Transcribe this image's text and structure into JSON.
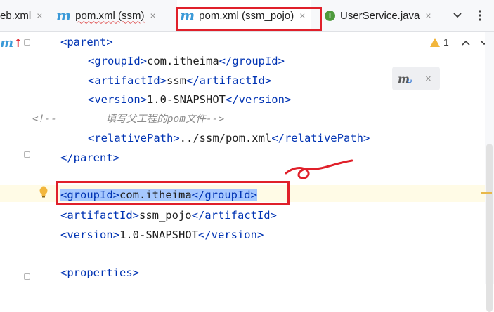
{
  "tabs": [
    {
      "label": "eb.xml",
      "icon": "xml-file-icon"
    },
    {
      "label": "pom.xml (ssm)",
      "icon": "maven-m-icon"
    },
    {
      "label": "pom.xml (ssm_pojo)",
      "icon": "maven-m-icon"
    },
    {
      "label": "UserService.java",
      "icon": "interface-i-icon"
    }
  ],
  "tab_close_glyph": "×",
  "warnings": {
    "count": "1"
  },
  "code_lines": {
    "l1": {
      "indent": "    ",
      "open": "<parent>"
    },
    "l2": {
      "indent": "        ",
      "open": "<groupId>",
      "text": "com.itheima",
      "close": "</groupId>"
    },
    "l3": {
      "indent": "        ",
      "open": "<artifactId>",
      "text": "ssm",
      "close": "</artifactId>"
    },
    "l4": {
      "indent": "        ",
      "open": "<version>",
      "text": "1.0-SNAPSHOT",
      "close": "</version>"
    },
    "l5": {
      "comment": "<!--        填写父工程的pom文件-->"
    },
    "l6": {
      "indent": "        ",
      "open": "<relativePath>",
      "text": "../ssm/pom.xml",
      "close": "</relativePath>"
    },
    "l7": {
      "indent": "    ",
      "close": "</parent>"
    },
    "l9": {
      "indent": "    ",
      "open": "<groupId>",
      "text": "com.itheima",
      "close": "</groupId>"
    },
    "l10": {
      "indent": "    ",
      "open": "<artifactId>",
      "text": "ssm_pojo",
      "close": "</artifactId>"
    },
    "l11": {
      "indent": "    ",
      "open": "<version>",
      "text": "1.0-SNAPSHOT",
      "close": "</version>"
    },
    "l13": {
      "indent": "    ",
      "open": "<properties>"
    }
  },
  "colors": {
    "tag": "#0033b3",
    "comment": "#8c8c8c",
    "annotation_red": "#e0202a",
    "selection": "#a6c8ff"
  }
}
